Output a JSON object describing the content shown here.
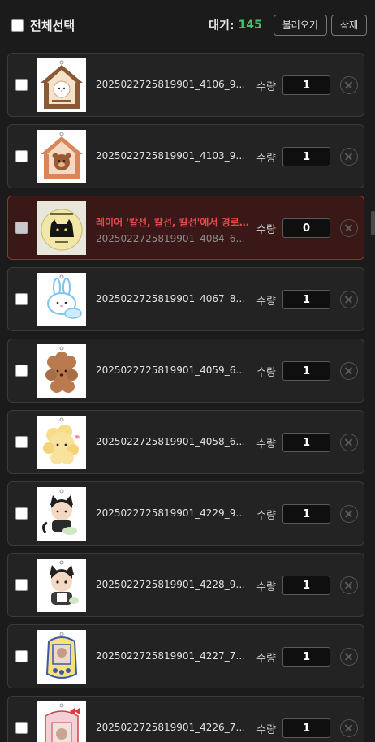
{
  "header": {
    "select_all_label": "전체선택",
    "wait_label": "대기:",
    "wait_count": "145",
    "load_button": "불러오기",
    "delete_button": "삭제"
  },
  "qty_label": "수량",
  "items": [
    {
      "filename": "2025022725819901_4106_90_...",
      "quantity": "1",
      "error": "",
      "icon": "house-cat-keyring"
    },
    {
      "filename": "2025022725819901_4103_90_...",
      "quantity": "1",
      "error": "",
      "icon": "house-bear-keyring"
    },
    {
      "filename": "2025022725819901_4084_60_...",
      "quantity": "0",
      "error": "레이어 '칼선, 칼선, 칼선'에서 경로 ...",
      "icon": "black-cat-keyring"
    },
    {
      "filename": "2025022725819901_4067_80_...",
      "quantity": "1",
      "error": "",
      "icon": "bunny-keyring"
    },
    {
      "filename": "2025022725819901_4059_60_...",
      "quantity": "1",
      "error": "",
      "icon": "poodle-keyring"
    },
    {
      "filename": "2025022725819901_4058_60_...",
      "quantity": "1",
      "error": "",
      "icon": "yellow-puppy-keyring"
    },
    {
      "filename": "2025022725819901_4229_90_...",
      "quantity": "1",
      "error": "",
      "icon": "black-cat-boy-keyring"
    },
    {
      "filename": "2025022725819901_4228_90_...",
      "quantity": "1",
      "error": "",
      "icon": "cat-boy-keyring"
    },
    {
      "filename": "2025022725819901_4227_70_...",
      "quantity": "1",
      "error": "",
      "icon": "photo-frame-keyring"
    },
    {
      "filename": "2025022725819901_4226_70_...",
      "quantity": "1",
      "error": "",
      "icon": "hello-kitty-frame-keyring"
    }
  ]
}
